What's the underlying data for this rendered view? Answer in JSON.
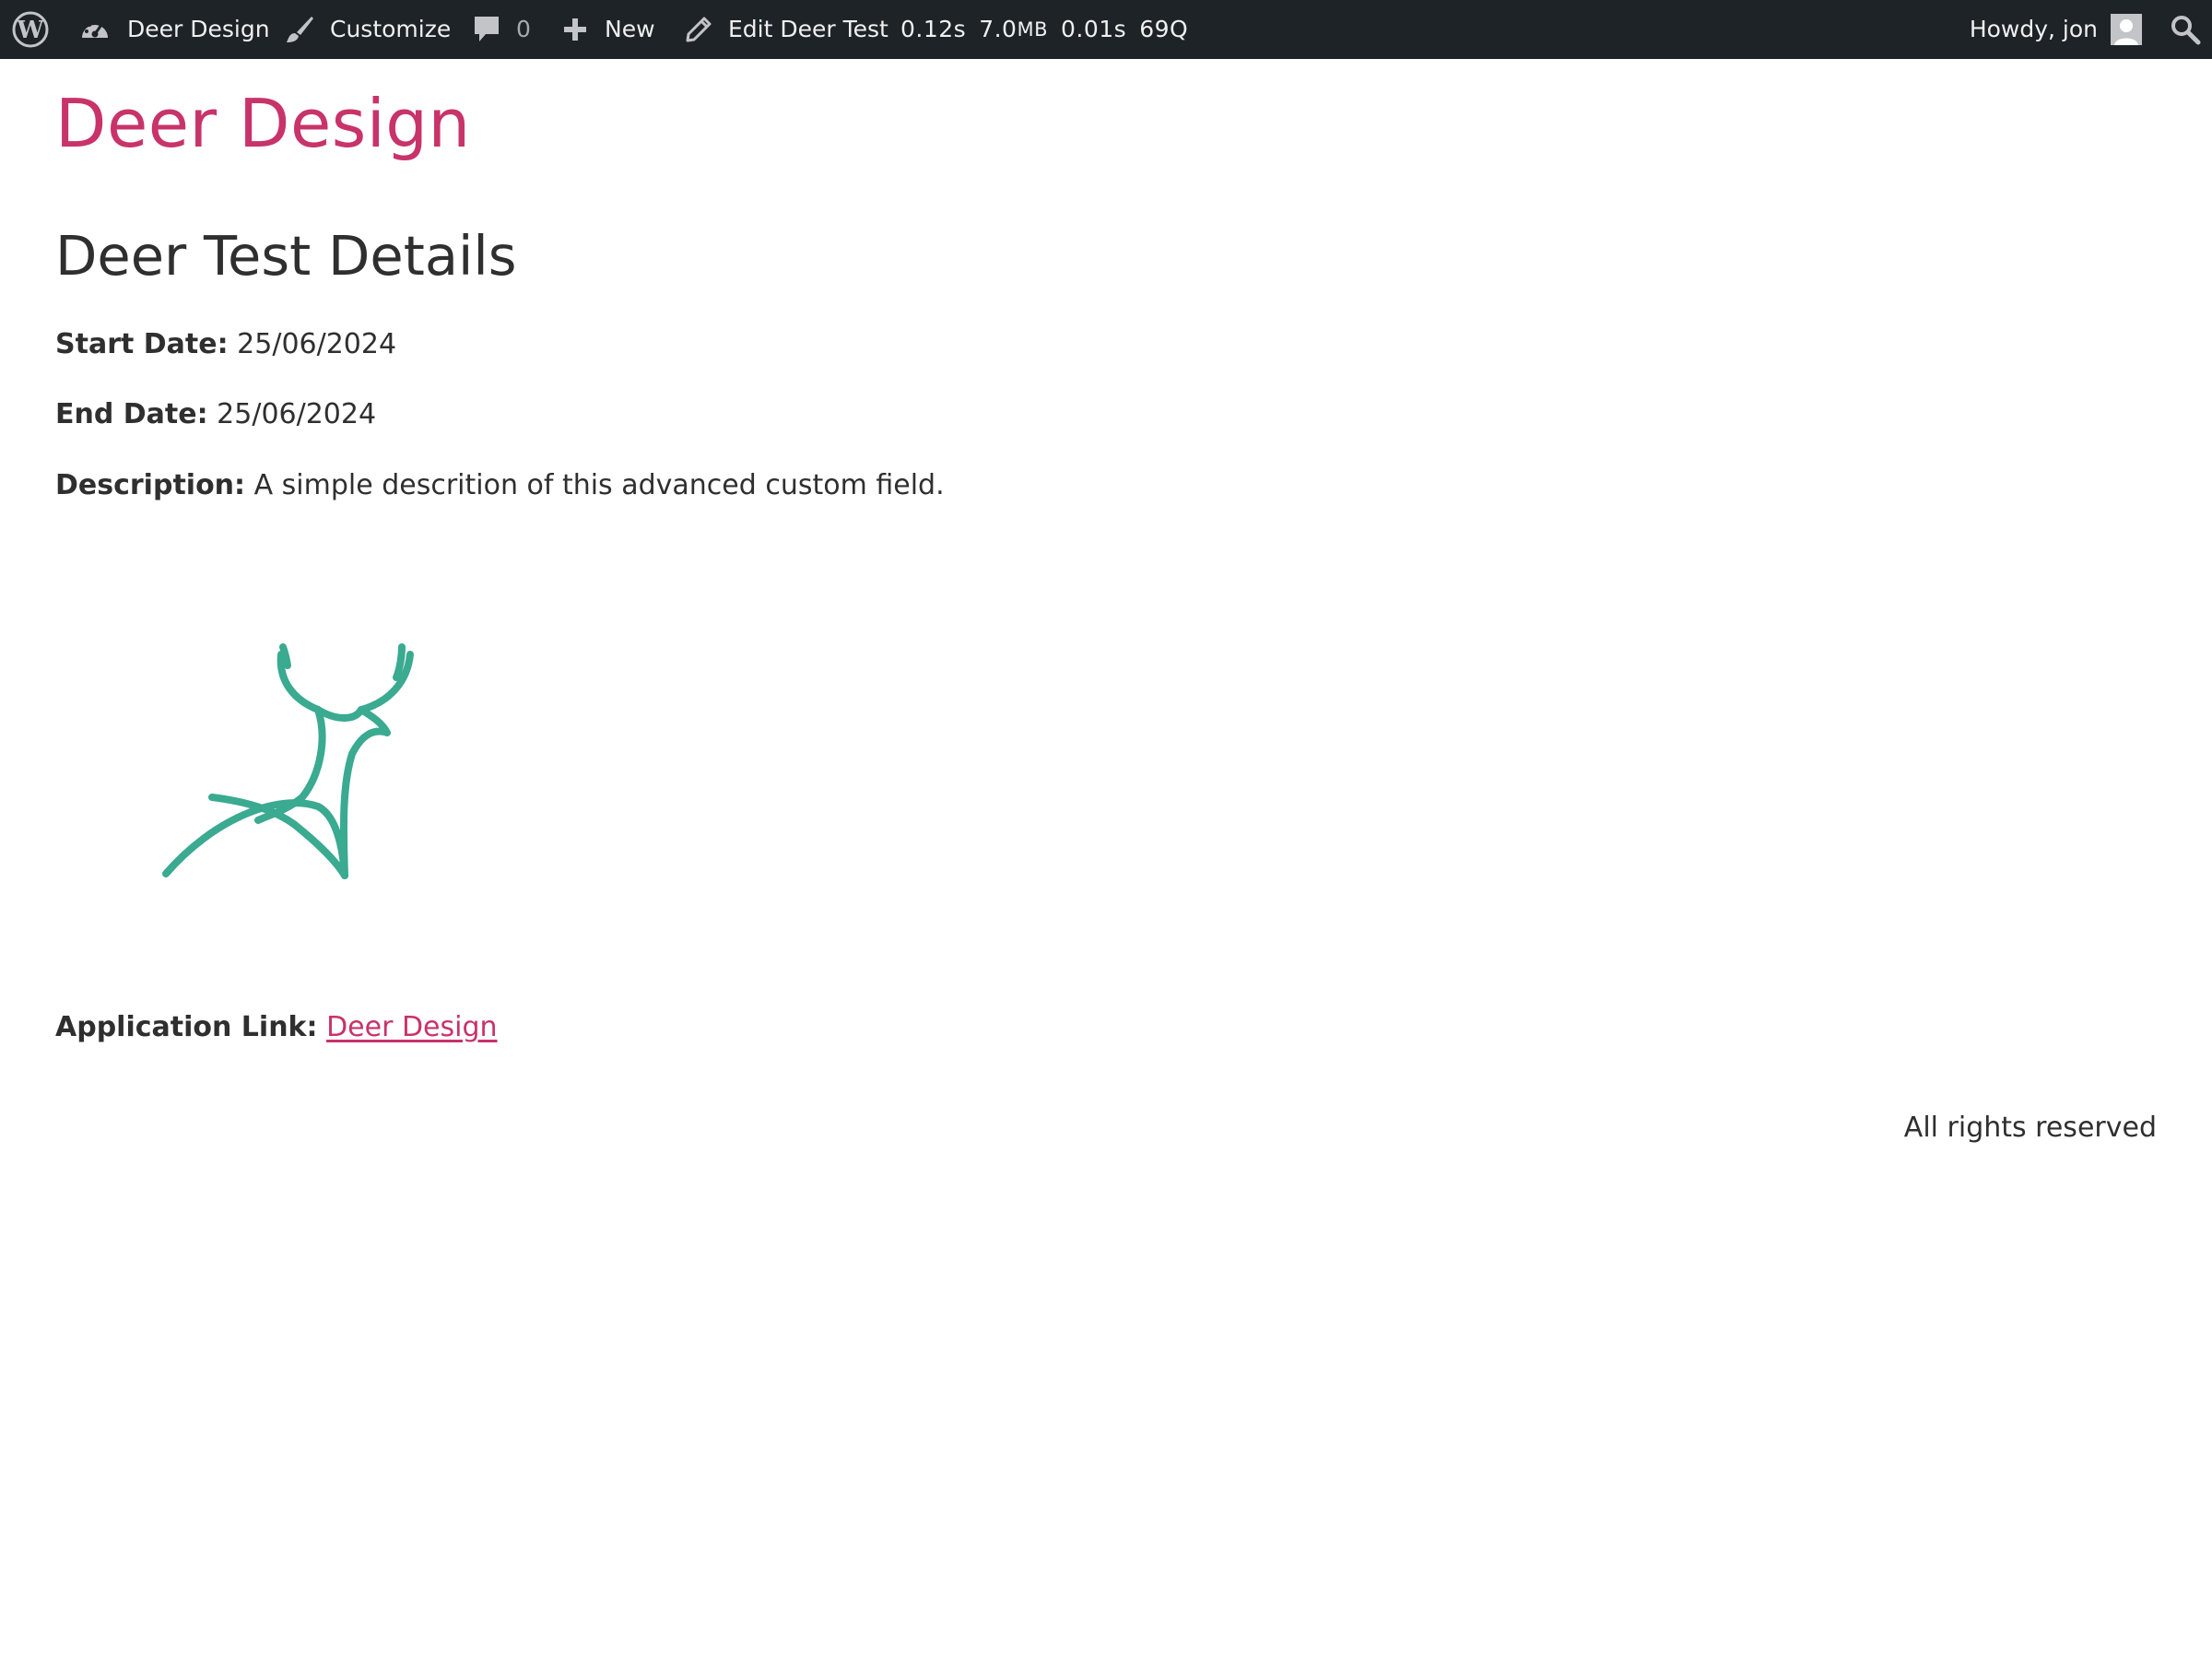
{
  "adminbar": {
    "site_name": "Deer Design",
    "customize": "Customize",
    "comments_count": "0",
    "new_label": "New",
    "edit_label": "Edit Deer Test",
    "stats": {
      "time": "0.12s",
      "memory": "7.0",
      "memory_unit": "MB",
      "query_time": "0.01s",
      "queries": "69Q"
    },
    "greeting": "Howdy, jon"
  },
  "site": {
    "title": "Deer Design"
  },
  "page": {
    "heading": "Deer Test Details",
    "fields": {
      "start_label": "Start Date:",
      "start_value": "25/06/2024",
      "end_label": "End Date:",
      "end_value": "25/06/2024",
      "description_label": "Description:",
      "description_value": "A simple descrition of this advanced custom field.",
      "link_label": "Application Link:",
      "link_text": "Deer Design"
    },
    "image": {
      "icon": "deer-logo-icon",
      "color": "#3aaa91"
    }
  },
  "footer": {
    "text": "All rights reserved"
  },
  "colors": {
    "accent": "#c8336a",
    "adminbar": "#1d2327",
    "logo": "#3aaa91"
  }
}
